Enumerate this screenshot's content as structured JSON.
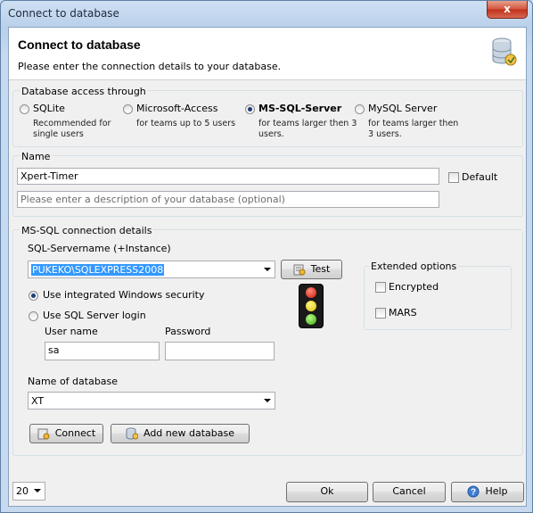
{
  "window": {
    "title": "Connect to database",
    "close_glyph": "x"
  },
  "header": {
    "title": "Connect to database",
    "subtitle": "Please enter the connection details to your database.",
    "icon": "database-connect-icon"
  },
  "access": {
    "group_label": "Database access through",
    "options": [
      {
        "label": "SQLite",
        "desc": "Recommended for\nsingle users",
        "checked": false
      },
      {
        "label": "Microsoft-Access",
        "desc": "for teams up to 5 users",
        "checked": false
      },
      {
        "label": "MS-SQL-Server",
        "desc": "for teams larger then 3\nusers.",
        "checked": true
      },
      {
        "label": "MySQL Server",
        "desc": "for teams larger then\n3 users.",
        "checked": false
      }
    ]
  },
  "name_group": {
    "label": "Name",
    "name_value": "Xpert-Timer",
    "default_label": "Default",
    "description_placeholder": "Please enter a description of your database (optional)"
  },
  "mssql": {
    "group_label": "MS-SQL connection details",
    "servername_label": "SQL-Servername (+Instance)",
    "servername_value": "PUKEKO\\SQLEXPRESS2008",
    "test_label": "Test",
    "integrated_label": "Use integrated Windows security",
    "sql_login_label": "Use SQL Server login",
    "username_label": "User name",
    "username_value": "sa",
    "password_label": "Password",
    "password_value": "",
    "dbname_label": "Name of database",
    "dbname_value": "XT",
    "connect_label": "Connect",
    "add_db_label": "Add new database",
    "extended": {
      "label": "Extended options",
      "encrypted_label": "Encrypted",
      "mars_label": "MARS"
    }
  },
  "footer": {
    "page_size_value": "20",
    "ok_label": "Ok",
    "cancel_label": "Cancel",
    "help_label": "Help"
  }
}
